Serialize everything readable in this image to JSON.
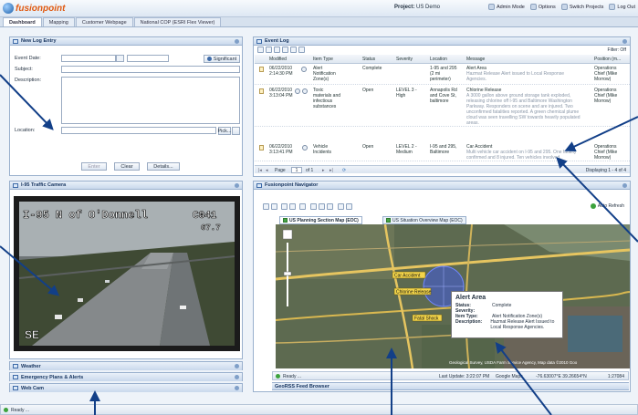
{
  "app": {
    "logo_text": "fusionpoint",
    "project_label": "Project:",
    "project_name": "US Demo",
    "links": [
      "Admin Mode",
      "Options",
      "Switch Projects",
      "Log Out"
    ]
  },
  "tabs": [
    "Dashboard",
    "Mapping",
    "Customer Webpage",
    "National COP (ESRI Flex Viewer)"
  ],
  "log_entry": {
    "title": "New Log Entry",
    "event_date_label": "Event Date:",
    "subject_label": "Subject:",
    "description_label": "Description:",
    "location_label": "Location:",
    "significant_label": "Significant",
    "pick_label": "Pick...",
    "enter_label": "Enter",
    "clear_label": "Clear",
    "details_label": "Details..."
  },
  "camera": {
    "title": "I-95 Traffic Camera",
    "overlay_line1": "I-95 N of O'Donnell",
    "overlay_code": "C041",
    "overlay_sub": "67.7",
    "overlay_dir": "SE"
  },
  "collapsed_panels": [
    "Weather",
    "Emergency Plans & Alerts",
    "Web Cam"
  ],
  "status_ready": "Ready ...",
  "event_log": {
    "title": "Event Log",
    "filter_label": "Filter: Off",
    "columns": [
      "Modified",
      "Item Type",
      "Status",
      "Severity",
      "Location",
      "Message",
      "Position (m..."
    ],
    "rows": [
      {
        "date": "06/22/2010",
        "time": "2:14:30 PM",
        "type": [
          "Alert",
          "Notification",
          "Zone(s)"
        ],
        "status": "Complete",
        "severity": "",
        "location": [
          "1-95 and 295",
          "(2 mi",
          "perimeter)"
        ],
        "msg_title": "Alert Area",
        "msg_body": [
          "Hazmat Release Alert issued to Local Response",
          "Agencies."
        ],
        "position": [
          "Operations",
          "Chief (Mike",
          "Morrow)"
        ]
      },
      {
        "date": "06/22/2010",
        "time": "3:13:04 PM",
        "type": [
          "Toxic",
          "materials and",
          "infectious",
          "substances"
        ],
        "status": "Open",
        "severity": "LEVEL 3 -",
        "severity2": "High",
        "location": [
          "Annapolis Rd",
          "and Cove St,",
          "baltimore"
        ],
        "msg_title": "Chlorine Release",
        "msg_body": [
          "A 3000 gallon above ground storage tank exploded,",
          "releasing chlorine off I-95 and Baltimore Washington",
          "Parkway. Responders on scene and are injured. Two",
          "unconfirmed fatalities reported. A green chemical plume",
          "cloud was seen travelling SW towards heavily populated",
          "areas."
        ],
        "position": [
          "Operations",
          "Chief (Mike",
          "Morrow)"
        ]
      },
      {
        "date": "06/22/2010",
        "time": "3:13:41 PM",
        "type": [
          "Vehicle",
          "Incidents"
        ],
        "status": "Open",
        "severity": "LEVEL 2 -",
        "severity2": "Medium",
        "location": [
          "I-95 and 295,",
          "Baltimore"
        ],
        "msg_title": "Car Accident",
        "msg_body": [
          "Multi vehicle car accident on I-95 and 295. One fatality",
          "confirmed and 8 injured. Ten vehicles involved."
        ],
        "position": [
          "Operations",
          "Chief (Mike",
          "Morrow)"
        ]
      }
    ],
    "pager_page_label": "Page",
    "pager_page": "1",
    "pager_of": "of 1",
    "pager_display": "Displaying 1 - 4 of 4"
  },
  "navigator": {
    "title": "Fusionpoint Navigator",
    "auto_refresh": "Auto Refresh",
    "map_tabs": [
      "US Planning Section Map (EOC)",
      "US Situation Overview Map (EOC)"
    ],
    "popup": {
      "title": "Alert Area",
      "rows": [
        {
          "k": "Status:",
          "v": "Complete"
        },
        {
          "k": "Severity:",
          "v": ""
        },
        {
          "k": "Item Type:",
          "v": "Alert Notification Zone(s)"
        },
        {
          "k": "Description:",
          "v": "Hazmat Release Alert Issued to Local Response Agencies."
        }
      ]
    },
    "map_labels": [
      "Car Accident",
      "Chlorine Release",
      "Fatal Shock"
    ],
    "attribution": "Geological Survey, USDA Farm Service Agency, Map data ©2010 Goo",
    "status_ready": "Ready ...",
    "last_update": "Last Update: 3:22:07 PM",
    "google_maps": "Google Maps",
    "coords": "-76.63007°E 39.26654°N",
    "scale": "1:27084",
    "geo_rss": "GeoRSS Feed Browser"
  },
  "colors": {
    "accent": "#1d4f91",
    "logo": "#e05a12",
    "callout": "#123f88"
  }
}
